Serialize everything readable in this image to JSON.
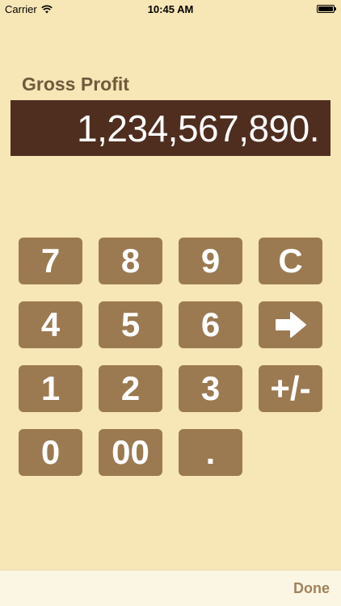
{
  "status_bar": {
    "carrier": "Carrier",
    "time": "10:45 AM",
    "wifi_icon": "wifi-icon",
    "battery_icon": "battery-icon"
  },
  "field": {
    "label": "Gross Profit",
    "value": "1,234,567,890."
  },
  "keypad": {
    "k7": "7",
    "k8": "8",
    "k9": "9",
    "clear": "C",
    "k4": "4",
    "k5": "5",
    "k6": "6",
    "enter_icon": "arrow-right-icon",
    "k1": "1",
    "k2": "2",
    "k3": "3",
    "sign": "+/-",
    "k0": "0",
    "k00": "00",
    "dot": "."
  },
  "toolbar": {
    "done_label": "Done"
  },
  "colors": {
    "background": "#f7e6b6",
    "display": "#4f2e1f",
    "key": "#9b7a52",
    "label": "#6f5a3c"
  }
}
